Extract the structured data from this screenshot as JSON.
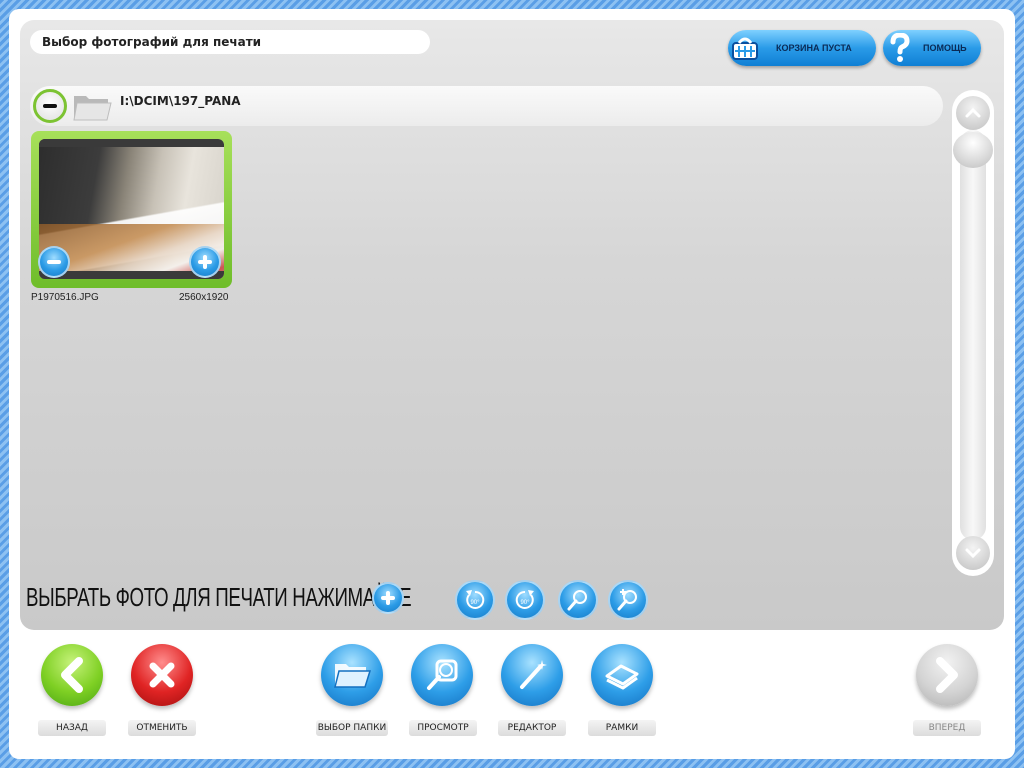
{
  "header": {
    "title": "Выбор фотографий для печати",
    "cart_label": "КОРЗИНА ПУСТА",
    "help_label": "ПОМОЩЬ"
  },
  "browser": {
    "path": "I:\\DCIM\\197_PANA",
    "photos": [
      {
        "name": "P1970516.JPG",
        "size": "2560x1920"
      }
    ]
  },
  "hint": {
    "text": "ВЫБРАТЬ ФОТО ДЛЯ ПЕЧАТИ НАЖИМАЙТЕ"
  },
  "tools": [
    {
      "icon": "rotate-left-icon"
    },
    {
      "icon": "rotate-right-icon"
    },
    {
      "icon": "zoom-out-icon"
    },
    {
      "icon": "zoom-in-icon"
    }
  ],
  "bottom": {
    "back_label": "НАЗАД",
    "cancel_label": "ОТМЕНИТЬ",
    "folder_label": "ВЫБОР ПАПКИ",
    "preview_label": "ПРОСМОТР",
    "editor_label": "РЕДАКТОР",
    "frames_label": "РАМКИ",
    "forward_label": "ВПЕРЕД"
  },
  "colors": {
    "accent_blue": "#2a9be8",
    "accent_green": "#7fd024",
    "accent_red": "#e02424",
    "background_blue": "#5a9ee6"
  }
}
